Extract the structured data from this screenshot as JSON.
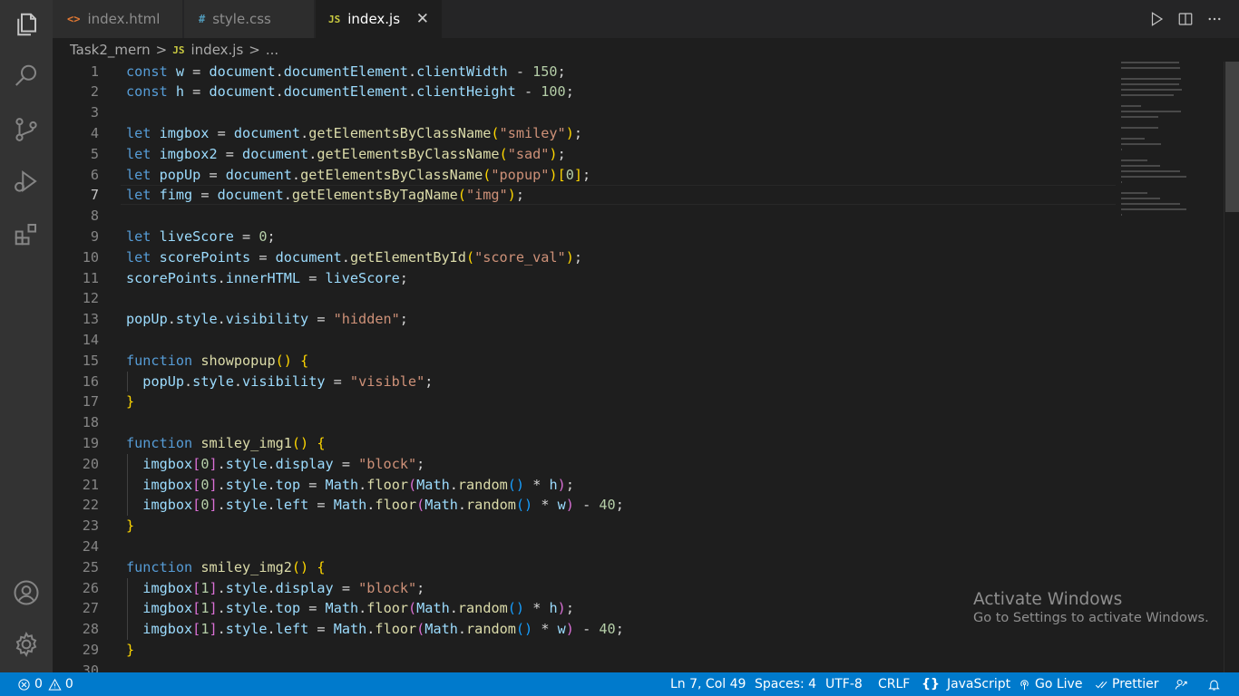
{
  "tabs": [
    {
      "icon": "<>",
      "label": "index.html",
      "icon_color": "#e37933"
    },
    {
      "icon": "#",
      "label": "style.css",
      "icon_color": "#519aba"
    },
    {
      "icon": "JS",
      "label": "index.js",
      "icon_color": "#cbcb41",
      "close": "✕"
    }
  ],
  "breadcrumb": {
    "folder": "Task2_mern",
    "sep": ">",
    "file": "index.js",
    "more": "..."
  },
  "current_line": 7,
  "code_lines": [
    [
      [
        "kw",
        "const"
      ],
      [
        "p",
        " "
      ],
      [
        "v",
        "w"
      ],
      [
        "p",
        " = "
      ],
      [
        "v",
        "document"
      ],
      [
        "p",
        "."
      ],
      [
        "v",
        "documentElement"
      ],
      [
        "p",
        "."
      ],
      [
        "v",
        "clientWidth"
      ],
      [
        "p",
        " - "
      ],
      [
        "n",
        "150"
      ],
      [
        "p",
        ";"
      ]
    ],
    [
      [
        "kw",
        "const"
      ],
      [
        "p",
        " "
      ],
      [
        "v",
        "h"
      ],
      [
        "p",
        " = "
      ],
      [
        "v",
        "document"
      ],
      [
        "p",
        "."
      ],
      [
        "v",
        "documentElement"
      ],
      [
        "p",
        "."
      ],
      [
        "v",
        "clientHeight"
      ],
      [
        "p",
        " - "
      ],
      [
        "n",
        "100"
      ],
      [
        "p",
        ";"
      ]
    ],
    [],
    [
      [
        "kw",
        "let"
      ],
      [
        "p",
        " "
      ],
      [
        "v",
        "imgbox"
      ],
      [
        "p",
        " = "
      ],
      [
        "v",
        "document"
      ],
      [
        "p",
        "."
      ],
      [
        "fn",
        "getElementsByClassName"
      ],
      [
        "b1",
        "("
      ],
      [
        "s",
        "\"smiley\""
      ],
      [
        "b1",
        ")"
      ],
      [
        "p",
        ";"
      ]
    ],
    [
      [
        "kw",
        "let"
      ],
      [
        "p",
        " "
      ],
      [
        "v",
        "imgbox2"
      ],
      [
        "p",
        " = "
      ],
      [
        "v",
        "document"
      ],
      [
        "p",
        "."
      ],
      [
        "fn",
        "getElementsByClassName"
      ],
      [
        "b1",
        "("
      ],
      [
        "s",
        "\"sad\""
      ],
      [
        "b1",
        ")"
      ],
      [
        "p",
        ";"
      ]
    ],
    [
      [
        "kw",
        "let"
      ],
      [
        "p",
        " "
      ],
      [
        "v",
        "popUp"
      ],
      [
        "p",
        " = "
      ],
      [
        "v",
        "document"
      ],
      [
        "p",
        "."
      ],
      [
        "fn",
        "getElementsByClassName"
      ],
      [
        "b1",
        "("
      ],
      [
        "s",
        "\"popup\""
      ],
      [
        "b1",
        ")"
      ],
      [
        "b1",
        "["
      ],
      [
        "n",
        "0"
      ],
      [
        "b1",
        "]"
      ],
      [
        "p",
        ";"
      ]
    ],
    [
      [
        "kw",
        "let"
      ],
      [
        "p",
        " "
      ],
      [
        "v",
        "fimg"
      ],
      [
        "p",
        " = "
      ],
      [
        "v",
        "document"
      ],
      [
        "p",
        "."
      ],
      [
        "fn",
        "getElementsByTagName"
      ],
      [
        "b1",
        "("
      ],
      [
        "s",
        "\"img\""
      ],
      [
        "b1",
        ")"
      ],
      [
        "p",
        ";"
      ]
    ],
    [],
    [
      [
        "kw",
        "let"
      ],
      [
        "p",
        " "
      ],
      [
        "v",
        "liveScore"
      ],
      [
        "p",
        " = "
      ],
      [
        "n",
        "0"
      ],
      [
        "p",
        ";"
      ]
    ],
    [
      [
        "kw",
        "let"
      ],
      [
        "p",
        " "
      ],
      [
        "v",
        "scorePoints"
      ],
      [
        "p",
        " = "
      ],
      [
        "v",
        "document"
      ],
      [
        "p",
        "."
      ],
      [
        "fn",
        "getElementById"
      ],
      [
        "b1",
        "("
      ],
      [
        "s",
        "\"score_val\""
      ],
      [
        "b1",
        ")"
      ],
      [
        "p",
        ";"
      ]
    ],
    [
      [
        "v",
        "scorePoints"
      ],
      [
        "p",
        "."
      ],
      [
        "v",
        "innerHTML"
      ],
      [
        "p",
        " = "
      ],
      [
        "v",
        "liveScore"
      ],
      [
        "p",
        ";"
      ]
    ],
    [],
    [
      [
        "v",
        "popUp"
      ],
      [
        "p",
        "."
      ],
      [
        "v",
        "style"
      ],
      [
        "p",
        "."
      ],
      [
        "v",
        "visibility"
      ],
      [
        "p",
        " = "
      ],
      [
        "s",
        "\"hidden\""
      ],
      [
        "p",
        ";"
      ]
    ],
    [],
    [
      [
        "kw",
        "function"
      ],
      [
        "p",
        " "
      ],
      [
        "fn",
        "showpopup"
      ],
      [
        "b1",
        "()"
      ],
      [
        "p",
        " "
      ],
      [
        "b1",
        "{"
      ]
    ],
    [
      [
        "p",
        "  "
      ],
      [
        "v",
        "popUp"
      ],
      [
        "p",
        "."
      ],
      [
        "v",
        "style"
      ],
      [
        "p",
        "."
      ],
      [
        "v",
        "visibility"
      ],
      [
        "p",
        " = "
      ],
      [
        "s",
        "\"visible\""
      ],
      [
        "p",
        ";"
      ]
    ],
    [
      [
        "b1",
        "}"
      ]
    ],
    [],
    [
      [
        "kw",
        "function"
      ],
      [
        "p",
        " "
      ],
      [
        "fn",
        "smiley_img1"
      ],
      [
        "b1",
        "()"
      ],
      [
        "p",
        " "
      ],
      [
        "b1",
        "{"
      ]
    ],
    [
      [
        "p",
        "  "
      ],
      [
        "v",
        "imgbox"
      ],
      [
        "b2",
        "["
      ],
      [
        "n",
        "0"
      ],
      [
        "b2",
        "]"
      ],
      [
        "p",
        "."
      ],
      [
        "v",
        "style"
      ],
      [
        "p",
        "."
      ],
      [
        "v",
        "display"
      ],
      [
        "p",
        " = "
      ],
      [
        "s",
        "\"block\""
      ],
      [
        "p",
        ";"
      ]
    ],
    [
      [
        "p",
        "  "
      ],
      [
        "v",
        "imgbox"
      ],
      [
        "b2",
        "["
      ],
      [
        "n",
        "0"
      ],
      [
        "b2",
        "]"
      ],
      [
        "p",
        "."
      ],
      [
        "v",
        "style"
      ],
      [
        "p",
        "."
      ],
      [
        "v",
        "top"
      ],
      [
        "p",
        " = "
      ],
      [
        "v",
        "Math"
      ],
      [
        "p",
        "."
      ],
      [
        "fn",
        "floor"
      ],
      [
        "b2",
        "("
      ],
      [
        "v",
        "Math"
      ],
      [
        "p",
        "."
      ],
      [
        "fn",
        "random"
      ],
      [
        "b3",
        "()"
      ],
      [
        "p",
        " * "
      ],
      [
        "v",
        "h"
      ],
      [
        "b2",
        ")"
      ],
      [
        "p",
        ";"
      ]
    ],
    [
      [
        "p",
        "  "
      ],
      [
        "v",
        "imgbox"
      ],
      [
        "b2",
        "["
      ],
      [
        "n",
        "0"
      ],
      [
        "b2",
        "]"
      ],
      [
        "p",
        "."
      ],
      [
        "v",
        "style"
      ],
      [
        "p",
        "."
      ],
      [
        "v",
        "left"
      ],
      [
        "p",
        " = "
      ],
      [
        "v",
        "Math"
      ],
      [
        "p",
        "."
      ],
      [
        "fn",
        "floor"
      ],
      [
        "b2",
        "("
      ],
      [
        "v",
        "Math"
      ],
      [
        "p",
        "."
      ],
      [
        "fn",
        "random"
      ],
      [
        "b3",
        "()"
      ],
      [
        "p",
        " * "
      ],
      [
        "v",
        "w"
      ],
      [
        "b2",
        ")"
      ],
      [
        "p",
        " - "
      ],
      [
        "n",
        "40"
      ],
      [
        "p",
        ";"
      ]
    ],
    [
      [
        "b1",
        "}"
      ]
    ],
    [],
    [
      [
        "kw",
        "function"
      ],
      [
        "p",
        " "
      ],
      [
        "fn",
        "smiley_img2"
      ],
      [
        "b1",
        "()"
      ],
      [
        "p",
        " "
      ],
      [
        "b1",
        "{"
      ]
    ],
    [
      [
        "p",
        "  "
      ],
      [
        "v",
        "imgbox"
      ],
      [
        "b2",
        "["
      ],
      [
        "n",
        "1"
      ],
      [
        "b2",
        "]"
      ],
      [
        "p",
        "."
      ],
      [
        "v",
        "style"
      ],
      [
        "p",
        "."
      ],
      [
        "v",
        "display"
      ],
      [
        "p",
        " = "
      ],
      [
        "s",
        "\"block\""
      ],
      [
        "p",
        ";"
      ]
    ],
    [
      [
        "p",
        "  "
      ],
      [
        "v",
        "imgbox"
      ],
      [
        "b2",
        "["
      ],
      [
        "n",
        "1"
      ],
      [
        "b2",
        "]"
      ],
      [
        "p",
        "."
      ],
      [
        "v",
        "style"
      ],
      [
        "p",
        "."
      ],
      [
        "v",
        "top"
      ],
      [
        "p",
        " = "
      ],
      [
        "v",
        "Math"
      ],
      [
        "p",
        "."
      ],
      [
        "fn",
        "floor"
      ],
      [
        "b2",
        "("
      ],
      [
        "v",
        "Math"
      ],
      [
        "p",
        "."
      ],
      [
        "fn",
        "random"
      ],
      [
        "b3",
        "()"
      ],
      [
        "p",
        " * "
      ],
      [
        "v",
        "h"
      ],
      [
        "b2",
        ")"
      ],
      [
        "p",
        ";"
      ]
    ],
    [
      [
        "p",
        "  "
      ],
      [
        "v",
        "imgbox"
      ],
      [
        "b2",
        "["
      ],
      [
        "n",
        "1"
      ],
      [
        "b2",
        "]"
      ],
      [
        "p",
        "."
      ],
      [
        "v",
        "style"
      ],
      [
        "p",
        "."
      ],
      [
        "v",
        "left"
      ],
      [
        "p",
        " = "
      ],
      [
        "v",
        "Math"
      ],
      [
        "p",
        "."
      ],
      [
        "fn",
        "floor"
      ],
      [
        "b2",
        "("
      ],
      [
        "v",
        "Math"
      ],
      [
        "p",
        "."
      ],
      [
        "fn",
        "random"
      ],
      [
        "b3",
        "()"
      ],
      [
        "p",
        " * "
      ],
      [
        "v",
        "w"
      ],
      [
        "b2",
        ")"
      ],
      [
        "p",
        " - "
      ],
      [
        "n",
        "40"
      ],
      [
        "p",
        ";"
      ]
    ],
    [
      [
        "b1",
        "}"
      ]
    ],
    []
  ],
  "watermark": {
    "title": "Activate Windows",
    "subtitle": "Go to Settings to activate Windows."
  },
  "status": {
    "errors": "0",
    "warnings": "0",
    "position": "Ln 7, Col 49",
    "spaces": "Spaces: 4",
    "encoding": "UTF-8",
    "eol": "CRLF",
    "language": "JavaScript",
    "golive": "Go Live",
    "prettier": "Prettier"
  },
  "colors": {
    "accent": "#007acc",
    "editor_bg": "#1e1e1e",
    "activity_bg": "#333333"
  },
  "icons": {
    "activity": [
      "files-icon",
      "search-icon",
      "source-control-icon",
      "run-debug-icon",
      "extensions-icon",
      "account-icon",
      "settings-gear-icon"
    ]
  }
}
